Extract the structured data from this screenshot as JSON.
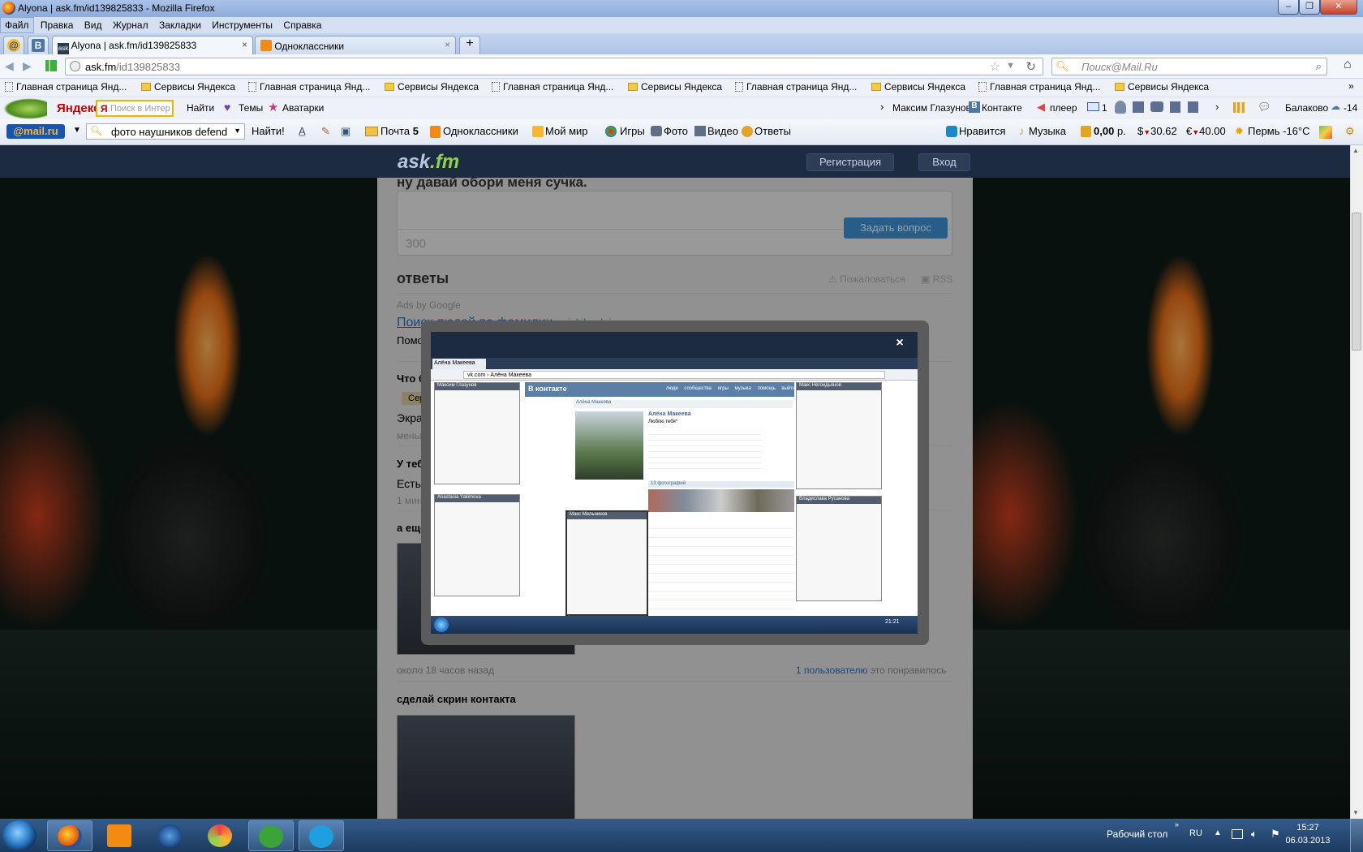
{
  "window": {
    "title": "Alyona | ask.fm/id139825833 - Mozilla Firefox"
  },
  "menubar": [
    "Файл",
    "Правка",
    "Вид",
    "Журнал",
    "Закладки",
    "Инструменты",
    "Справка"
  ],
  "tabs": [
    {
      "label": "Alyona | ask.fm/id139825833",
      "active": true
    },
    {
      "label": "Одноклассники",
      "active": false
    }
  ],
  "nav": {
    "url_host": "ask.fm",
    "url_path": "/id139825833",
    "search_placeholder": "Поиск@Mail.Ru"
  },
  "bookmarks": [
    {
      "label": "Главная страница Янд...",
      "type": "page"
    },
    {
      "label": "Сервисы Яндекса",
      "type": "folder"
    },
    {
      "label": "Главная страница Янд...",
      "type": "page"
    },
    {
      "label": "Сервисы Яндекса",
      "type": "folder"
    },
    {
      "label": "Главная страница Янд...",
      "type": "page"
    },
    {
      "label": "Сервисы Яндекса",
      "type": "folder"
    },
    {
      "label": "Главная страница Янд...",
      "type": "page"
    },
    {
      "label": "Сервисы Яндекса",
      "type": "folder"
    },
    {
      "label": "Главная страница Янд...",
      "type": "page"
    },
    {
      "label": "Сервисы Яндекса",
      "type": "folder"
    }
  ],
  "yandex_bar": {
    "logo": "Яндекс",
    "search_placeholder": "Поиск в Интер",
    "find": "Найти",
    "themes": "Темы",
    "avatars": "Аватарки",
    "user": "Максим Глазунов",
    "vk": "Контакте",
    "player": "плеер",
    "mail_count": "1",
    "city": "Балаково",
    "temp": "-14"
  },
  "mail_bar": {
    "logo": "@mail.ru",
    "search_value": "фото наушников defend",
    "find": "Найти!",
    "mail": "Почта",
    "mail_count": "5",
    "ok": "Одноклассники",
    "myworld": "Мой мир",
    "games": "Игры",
    "photo": "Фото",
    "video": "Видео",
    "answers": "Ответы",
    "like": "Нравится",
    "music": "Музыка",
    "balance": "0,00",
    "balance_unit": "р.",
    "usd": "30.62",
    "eur": "40.00",
    "weather": "Пермь -16°C"
  },
  "askfm": {
    "logo_a": "ask",
    "logo_b": ".fm",
    "register": "Регистрация",
    "login": "Вход",
    "question_prompt": "ну давай обори меня сучка.",
    "char_count": "300",
    "ask_button": "Задать вопрос",
    "answers_heading": "ответы",
    "report": "Пожаловаться",
    "rss": "RSS",
    "ads_label": "Ads by Google",
    "ad_title": "Поиск людей по фамилии",
    "ad_domain": "poiskilyudei.ru",
    "ad_snippet": "Помож",
    "q1": "Что бы",
    "q1_badge": "Сере",
    "q1_text": "Экран",
    "q1_time": "меньше",
    "q2": "У тебя",
    "q2_text": "Есть.Н",
    "q2_time": "1 минут",
    "q3": "а ещё",
    "time_ago": "около 18 часов назад",
    "likes_link": "1 пользователю",
    "likes_rest": "это понравилось",
    "q4": "сделай скрин контакта"
  },
  "modal": {
    "close": "×",
    "inner_tab": "Алёна Макеева",
    "inner_url": "vk.com › Алёна Макеева",
    "vk_logo": "В контакте",
    "vk_nav": [
      "люди",
      "сообщества",
      "игры",
      "музыка",
      "помощь",
      "выйти"
    ],
    "profile_name": "Алёна Макеева",
    "profile_status": "Люблю тебя*",
    "photos": "13 фотографий",
    "chat1": "Максим Глазунов",
    "chat2": "Макс Негоидьянов",
    "chat3": "Anastasia Yakimova",
    "chat4": "Макс Мельников",
    "chat5": "Владислава Русанова",
    "inner_clock": "21:21"
  },
  "taskbar": {
    "desktop_label": "Рабочий стол",
    "lang": "RU",
    "time": "15:27",
    "date": "06.03.2013"
  }
}
